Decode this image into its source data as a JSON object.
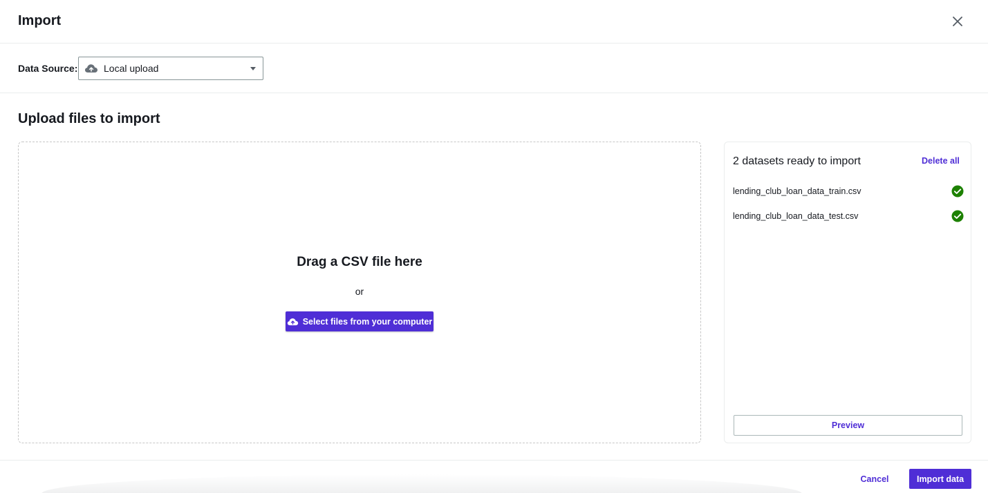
{
  "header": {
    "title": "Import",
    "close_icon": "close-icon"
  },
  "data_source": {
    "label": "Data Source:",
    "selected": "Local upload",
    "icon": "cloud-upload-icon"
  },
  "upload": {
    "section_title": "Upload files to import",
    "drop_title": "Drag a CSV file here",
    "or_text": "or",
    "select_button_label": "Select files from your computer",
    "select_button_icon": "cloud-upload-icon"
  },
  "datasets_panel": {
    "title": "2 datasets ready to import",
    "delete_all_label": "Delete all",
    "files": [
      {
        "name": "lending_club_loan_data_train.csv",
        "status_icon": "check-circle-icon"
      },
      {
        "name": "lending_club_loan_data_test.csv",
        "status_icon": "check-circle-icon"
      }
    ],
    "preview_label": "Preview"
  },
  "footer": {
    "cancel_label": "Cancel",
    "import_label": "Import data"
  },
  "colors": {
    "accent": "#4f2ed6",
    "success": "#1d8102",
    "text": "#16191f",
    "border": "#eaeded"
  }
}
